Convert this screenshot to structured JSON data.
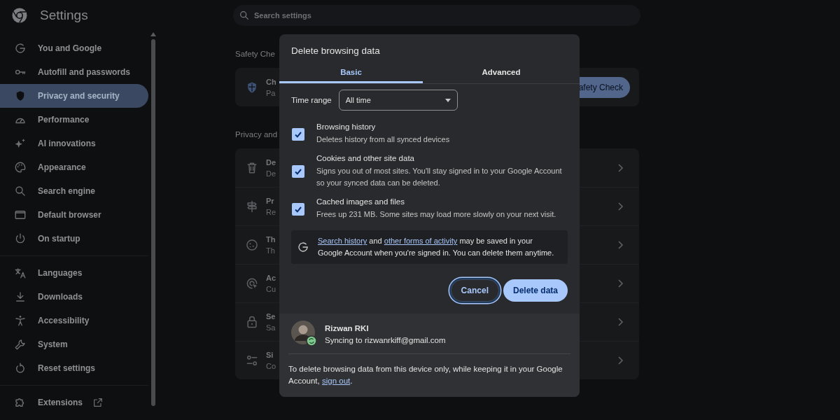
{
  "app": {
    "title": "Settings"
  },
  "sidebar": {
    "sections": [
      {
        "items": [
          {
            "label": "You and Google",
            "selected": false
          },
          {
            "label": "Autofill and passwords",
            "selected": false
          },
          {
            "label": "Privacy and security",
            "selected": true
          },
          {
            "label": "Performance",
            "selected": false
          },
          {
            "label": "AI innovations",
            "selected": false
          },
          {
            "label": "Appearance",
            "selected": false
          },
          {
            "label": "Search engine",
            "selected": false
          },
          {
            "label": "Default browser",
            "selected": false
          },
          {
            "label": "On startup",
            "selected": false
          }
        ]
      },
      {
        "items": [
          {
            "label": "Languages",
            "selected": false
          },
          {
            "label": "Downloads",
            "selected": false
          },
          {
            "label": "Accessibility",
            "selected": false
          },
          {
            "label": "System",
            "selected": false
          },
          {
            "label": "Reset settings",
            "selected": false
          }
        ]
      },
      {
        "items": [
          {
            "label": "Extensions",
            "selected": false,
            "external": true
          }
        ]
      }
    ]
  },
  "search": {
    "placeholder": "Search settings"
  },
  "safety_check": {
    "heading": "Safety Che",
    "row": {
      "title": "Ch",
      "subtitle": "Pa"
    },
    "button": "afety Check"
  },
  "privacy": {
    "heading": "Privacy and",
    "rows": [
      {
        "title": "De",
        "subtitle": "De"
      },
      {
        "title": "Pr",
        "subtitle": "Re"
      },
      {
        "title": "Th",
        "subtitle": "Th"
      },
      {
        "title": "Ac",
        "subtitle": "Cu"
      },
      {
        "title": "Se",
        "subtitle": "Sa"
      },
      {
        "title": "Si",
        "subtitle": "Co"
      }
    ]
  },
  "dialog": {
    "title": "Delete browsing data",
    "tabs": [
      {
        "label": "Basic",
        "selected": true
      },
      {
        "label": "Advanced",
        "selected": false
      }
    ],
    "time_range": {
      "label": "Time range",
      "value": "All time"
    },
    "options": [
      {
        "title": "Browsing history",
        "description": "Deletes history from all synced devices",
        "checked": true
      },
      {
        "title": "Cookies and other site data",
        "description": "Signs you out of most sites. You'll stay signed in to your Google Account so your synced data can be deleted.",
        "checked": true
      },
      {
        "title": "Cached images and files",
        "description": "Frees up 231 MB. Some sites may load more slowly on your next visit.",
        "checked": true
      }
    ],
    "info": [
      {
        "kind": "link",
        "text": "Search history"
      },
      {
        "kind": "text",
        "text": " and "
      },
      {
        "kind": "link",
        "text": "other forms of activity"
      },
      {
        "kind": "text",
        "text": " may be saved in your Google Account when you're signed in. You can delete them anytime."
      }
    ],
    "buttons": [
      {
        "label": "Cancel",
        "kind": "secondary",
        "focused": true
      },
      {
        "label": "Delete data",
        "kind": "primary",
        "focused": false
      }
    ],
    "account": {
      "name": "Rizwan RKI",
      "status": "Syncing to rizwanrkiff@gmail.com"
    },
    "footer": [
      {
        "kind": "text",
        "text": "To delete browsing data from this device only, while keeping it in your Google Account, "
      },
      {
        "kind": "link",
        "text": "sign out"
      },
      {
        "kind": "text",
        "text": "."
      }
    ]
  }
}
